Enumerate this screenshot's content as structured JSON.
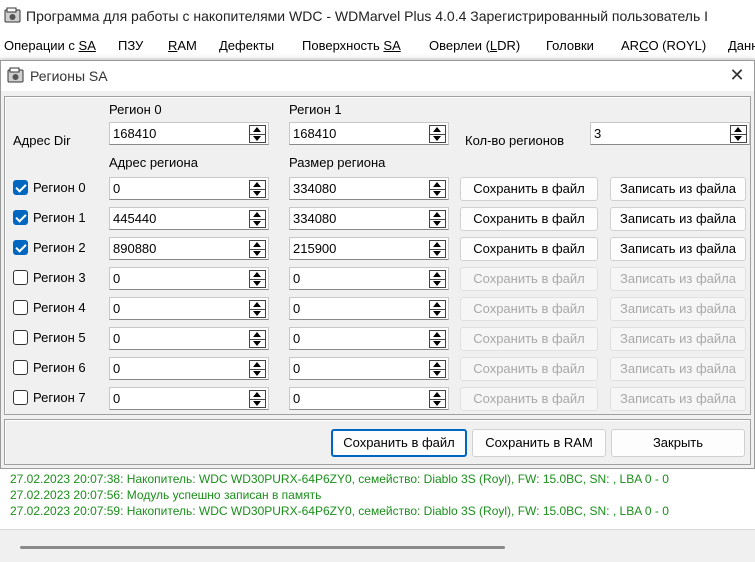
{
  "main_window": {
    "title": "Программа для работы с накопителями WDC - WDMarvel Plus 4.0.4 Зарегистрированный пользователь I"
  },
  "menu": {
    "items": [
      {
        "pre": "Операции с ",
        "ul": "SA",
        "post": ""
      },
      {
        "pre": "",
        "ul": "",
        "post": "ПЗУ"
      },
      {
        "pre": "",
        "ul": "R",
        "post": "AM"
      },
      {
        "pre": "",
        "ul": "",
        "post": "Дефекты"
      },
      {
        "pre": "Поверхность ",
        "ul": "SA",
        "post": ""
      },
      {
        "pre": "Оверлеи (",
        "ul": "L",
        "post": "DR)"
      },
      {
        "pre": "",
        "ul": "",
        "post": "Головки"
      },
      {
        "pre": "AR",
        "ul": "C",
        "post": "O (ROYL)"
      },
      {
        "pre": "",
        "ul": "",
        "post": "Данн"
      }
    ]
  },
  "dialog": {
    "title": "Регионы SA",
    "close_icon": "close-icon",
    "labels": {
      "region0": "Регион 0",
      "region1": "Регион 1",
      "addr_dir": "Адрес Dir",
      "count": "Кол-во регионов",
      "region_addr": "Адрес региона",
      "region_size": "Размер региона"
    },
    "dir": {
      "region0": "168410",
      "region1": "168410"
    },
    "region_count": "3",
    "regions": [
      {
        "label": "Регион 0",
        "checked": true,
        "addr": "0",
        "size": "334080",
        "save": "Сохранить в файл",
        "load": "Записать из файла"
      },
      {
        "label": "Регион 1",
        "checked": true,
        "addr": "445440",
        "size": "334080",
        "save": "Сохранить в файл",
        "load": "Записать из файла"
      },
      {
        "label": "Регион 2",
        "checked": true,
        "addr": "890880",
        "size": "215900",
        "save": "Сохранить в файл",
        "load": "Записать из файла"
      },
      {
        "label": "Регион 3",
        "checked": false,
        "addr": "0",
        "size": "0",
        "save": "Сохранить в файл",
        "load": "Записать из файла"
      },
      {
        "label": "Регион 4",
        "checked": false,
        "addr": "0",
        "size": "0",
        "save": "Сохранить в файл",
        "load": "Записать из файла"
      },
      {
        "label": "Регион 5",
        "checked": false,
        "addr": "0",
        "size": "0",
        "save": "Сохранить в файл",
        "load": "Записать из файла"
      },
      {
        "label": "Регион 6",
        "checked": false,
        "addr": "0",
        "size": "0",
        "save": "Сохранить в файл",
        "load": "Записать из файла"
      },
      {
        "label": "Регион 7",
        "checked": false,
        "addr": "0",
        "size": "0",
        "save": "Сохранить в файл",
        "load": "Записать из файла"
      }
    ],
    "footer": {
      "save_file": "Сохранить в файл",
      "save_ram": "Сохранить в RAM",
      "close": "Закрыть"
    }
  },
  "log": [
    "27.02.2023 20:07:38: Накопитель: WDC WD30PURX-64P6ZY0, семейство: Diablo 3S (Royl), FW: 15.0BC, SN: , LBA 0 - 0",
    "27.02.2023 20:07:56: Модуль успешно записан в память",
    "27.02.2023 20:07:59: Накопитель: WDC WD30PURX-64P6ZY0, семейство: Diablo 3S (Royl), FW: 15.0BC, SN: , LBA 0 - 0"
  ],
  "colors": {
    "accent": "#0067c0",
    "log_text": "#1a8f1a"
  }
}
